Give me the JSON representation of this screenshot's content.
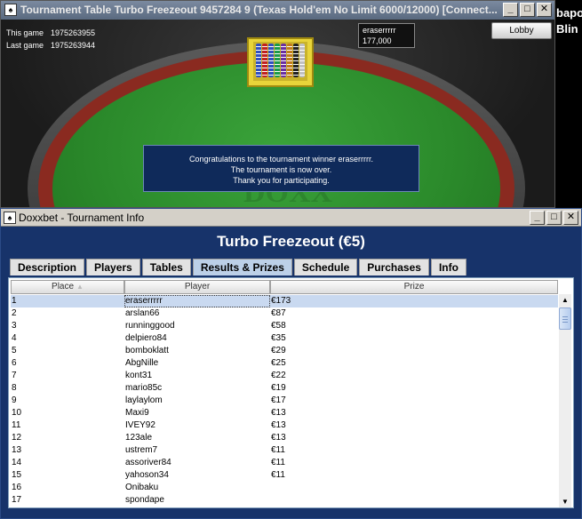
{
  "game_window": {
    "title": "Tournament Table Turbo Freezeout 9457284 9 (Texas Hold'em No Limit 6000/12000)  [Connect...",
    "app_icon_glyph": "♠",
    "buttons": {
      "minimize": "_",
      "maximize": "□",
      "close": "✕"
    },
    "this_game_label": "This game",
    "this_game_id": "1975263955",
    "last_game_label": "Last game",
    "last_game_id": "1975263944",
    "seat_player": "eraserrrrr",
    "seat_chips": "177,000",
    "lobby_label": "Lobby",
    "felt_logo": "DOXX",
    "message_lines": [
      "Congratulations to the tournament winner eraserrrrr.",
      "The tournament is now over.",
      "Thank you for participating."
    ],
    "chip_colors": [
      "#2f4fc0",
      "#c02020",
      "#2f4fc0",
      "#1a9a4a",
      "#6a2fa0",
      "#c07a1a",
      "#222222",
      "#c0c0c0"
    ],
    "felt_color": "#2b8a2b",
    "rim_color": "#8a2a20"
  },
  "background": {
    "text_lines": [
      "bapo",
      "Blin"
    ]
  },
  "info_window": {
    "title": "Doxxbet - Tournament Info",
    "app_icon_glyph": "♠",
    "buttons": {
      "minimize": "_",
      "maximize": "□",
      "close": "✕"
    },
    "heading": "Turbo Freezeout (€5)",
    "tabs": [
      {
        "label": "Description",
        "active": false
      },
      {
        "label": "Players",
        "active": false
      },
      {
        "label": "Tables",
        "active": false
      },
      {
        "label": "Results & Prizes",
        "active": true
      },
      {
        "label": "Schedule",
        "active": false
      },
      {
        "label": "Purchases",
        "active": false
      },
      {
        "label": "Info",
        "active": false
      }
    ],
    "columns": {
      "place": "Place",
      "player": "Player",
      "prize": "Prize"
    },
    "sort_indicator": "▲",
    "rows": [
      {
        "place": "1",
        "player": "eraserrrrr",
        "prize": "€173",
        "selected": true
      },
      {
        "place": "2",
        "player": "arslan66",
        "prize": "€87"
      },
      {
        "place": "3",
        "player": "runninggood",
        "prize": "€58"
      },
      {
        "place": "4",
        "player": "delpiero84",
        "prize": "€35"
      },
      {
        "place": "5",
        "player": "bomboklatt",
        "prize": "€29"
      },
      {
        "place": "6",
        "player": "AbgNille",
        "prize": "€25"
      },
      {
        "place": "7",
        "player": "kont31",
        "prize": "€22"
      },
      {
        "place": "8",
        "player": "mario85c",
        "prize": "€19"
      },
      {
        "place": "9",
        "player": "laylaylom",
        "prize": "€17"
      },
      {
        "place": "10",
        "player": "Maxi9",
        "prize": "€13"
      },
      {
        "place": "11",
        "player": "IVEY92",
        "prize": "€13"
      },
      {
        "place": "12",
        "player": "123ale",
        "prize": "€13"
      },
      {
        "place": "13",
        "player": "ustrem7",
        "prize": "€11"
      },
      {
        "place": "14",
        "player": "assoriver84",
        "prize": "€11"
      },
      {
        "place": "15",
        "player": "yahoson34",
        "prize": "€11"
      },
      {
        "place": "16",
        "player": "Onibaku",
        "prize": ""
      },
      {
        "place": "17",
        "player": "spondape",
        "prize": ""
      }
    ],
    "scroll_up_glyph": "▲",
    "scroll_down_glyph": "▼",
    "accent_color": "#17336a",
    "selected_row_color": "#c9d9f0"
  }
}
